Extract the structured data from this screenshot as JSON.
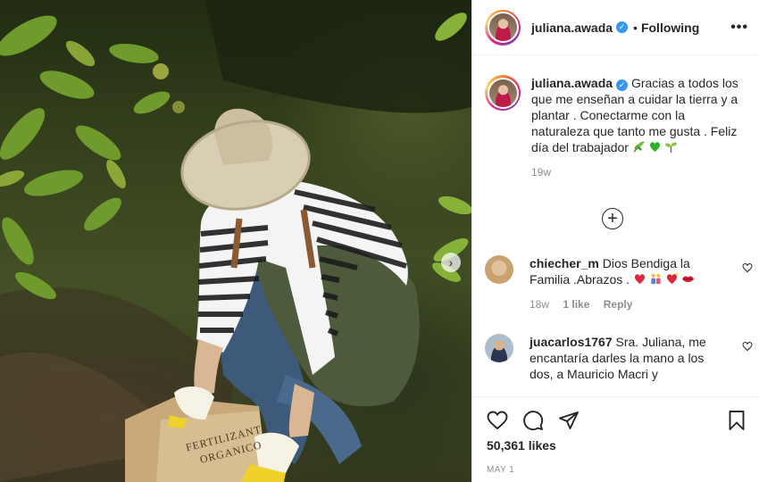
{
  "post": {
    "username": "juliana.awada",
    "follow_status": "Following",
    "more_glyph": "•••",
    "caption": "Gracias a todos los que me enseñan a cuidar la tierra y a plantar . Conectarme con la naturaleza que tanto me gusta . Feliz día del trabajador",
    "caption_emojis": [
      "herb-emoji",
      "green-heart-emoji",
      "seedling-emoji"
    ],
    "caption_time": "19w",
    "likes": "50,361 likes",
    "date": "MAY 1"
  },
  "photo": {
    "bag_text_line1": "FERTILIZANTE",
    "bag_text_line2": "ORGANICO"
  },
  "comments": [
    {
      "username": "chiecher_m",
      "text": "Dios Bendiga la Familia .Abrazos .",
      "emojis": [
        "red-heart-emoji",
        "family-emoji",
        "heart-kiss-emoji",
        "lips-emoji"
      ],
      "time": "18w",
      "likes": "1 like",
      "reply": "Reply"
    },
    {
      "username": "juacarlos1767",
      "text": "Sra. Juliana, me encantaría darles la mano a los dos, a Mauricio Macri y"
    }
  ],
  "icons": {
    "verified": "verified-badge-icon",
    "load_more": "plus-circle-icon",
    "like": "heart-icon",
    "comment": "comment-bubble-icon",
    "share": "paper-plane-icon",
    "save": "bookmark-icon",
    "next": "chevron-right-icon"
  },
  "colors": {
    "verified": "#3897f0",
    "meta_text": "#8e8e8e",
    "text": "#262626",
    "border": "#efefef"
  }
}
